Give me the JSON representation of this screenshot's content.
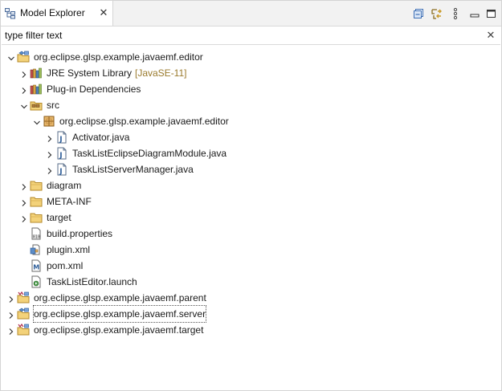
{
  "tab": {
    "title": "Model Explorer",
    "icon": "model-explorer-icon"
  },
  "toolbar": {
    "buttons": [
      {
        "name": "collapse-all-button",
        "icon": "collapse-all-icon"
      },
      {
        "name": "link-with-editor-button",
        "icon": "link-with-editor-icon"
      },
      {
        "name": "view-menu-button",
        "icon": "kebab-menu-icon"
      },
      {
        "name": "minimize-button",
        "icon": "minimize-icon"
      },
      {
        "name": "maximize-button",
        "icon": "maximize-icon"
      }
    ]
  },
  "filter": {
    "placeholder": "type filter text"
  },
  "tree": [
    {
      "label": "org.eclipse.glsp.example.javaemf.editor",
      "icon": "java-project-icon",
      "level": 0,
      "expander": "expanded"
    },
    {
      "label": "JRE System Library",
      "decoration": "[JavaSE-11]",
      "icon": "library-icon",
      "level": 1,
      "expander": "collapsed"
    },
    {
      "label": "Plug-in Dependencies",
      "icon": "library-icon",
      "level": 1,
      "expander": "collapsed"
    },
    {
      "label": "src",
      "icon": "source-folder-icon",
      "level": 1,
      "expander": "expanded"
    },
    {
      "label": "org.eclipse.glsp.example.javaemf.editor",
      "icon": "package-icon",
      "level": 2,
      "expander": "expanded"
    },
    {
      "label": "Activator.java",
      "icon": "java-file-icon",
      "level": 3,
      "expander": "collapsed"
    },
    {
      "label": "TaskListEclipseDiagramModule.java",
      "icon": "java-file-icon",
      "level": 3,
      "expander": "collapsed"
    },
    {
      "label": "TaskListServerManager.java",
      "icon": "java-file-icon",
      "level": 3,
      "expander": "collapsed"
    },
    {
      "label": "diagram",
      "icon": "folder-icon",
      "level": 1,
      "expander": "collapsed"
    },
    {
      "label": "META-INF",
      "icon": "folder-icon",
      "level": 1,
      "expander": "collapsed"
    },
    {
      "label": "target",
      "icon": "folder-icon",
      "level": 1,
      "expander": "collapsed"
    },
    {
      "label": "build.properties",
      "icon": "properties-file-icon",
      "level": 1,
      "expander": "none"
    },
    {
      "label": "plugin.xml",
      "icon": "plugin-xml-icon",
      "level": 1,
      "expander": "none"
    },
    {
      "label": "pom.xml",
      "icon": "maven-pom-icon",
      "level": 1,
      "expander": "none"
    },
    {
      "label": "TaskListEditor.launch",
      "icon": "launch-config-icon",
      "level": 1,
      "expander": "none"
    },
    {
      "label": "org.eclipse.glsp.example.javaemf.parent",
      "icon": "maven-project-icon",
      "level": 0,
      "expander": "collapsed"
    },
    {
      "label": "org.eclipse.glsp.example.javaemf.server",
      "icon": "java-project-icon",
      "level": 0,
      "expander": "collapsed",
      "selected": true
    },
    {
      "label": "org.eclipse.glsp.example.javaemf.target",
      "icon": "maven-project-icon",
      "level": 0,
      "expander": "collapsed"
    }
  ]
}
